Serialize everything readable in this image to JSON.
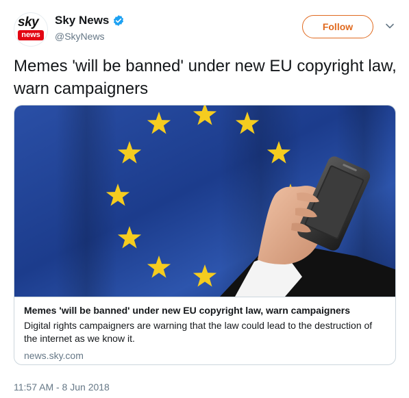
{
  "author": {
    "avatar_logo_top": "sky",
    "avatar_logo_bottom": "news",
    "display_name": "Sky News",
    "handle": "@SkyNews"
  },
  "follow_label": "Follow",
  "tweet_text": "Memes 'will be banned' under new EU copyright law, warn campaigners",
  "card": {
    "title": "Memes 'will be banned' under new EU copyright law, warn campaigners",
    "description": "Digital rights campaigners are warning that the law could lead to the destruction of the internet as we know it.",
    "domain": "news.sky.com"
  },
  "timestamp": "11:57 AM - 8 Jun 2018",
  "colors": {
    "follow_accent": "#e0691e",
    "verified_blue": "#1da1f2",
    "sky_news_red": "#e30613",
    "eu_blue": "#1f3f8f",
    "eu_star_yellow": "#f5cc1f"
  }
}
